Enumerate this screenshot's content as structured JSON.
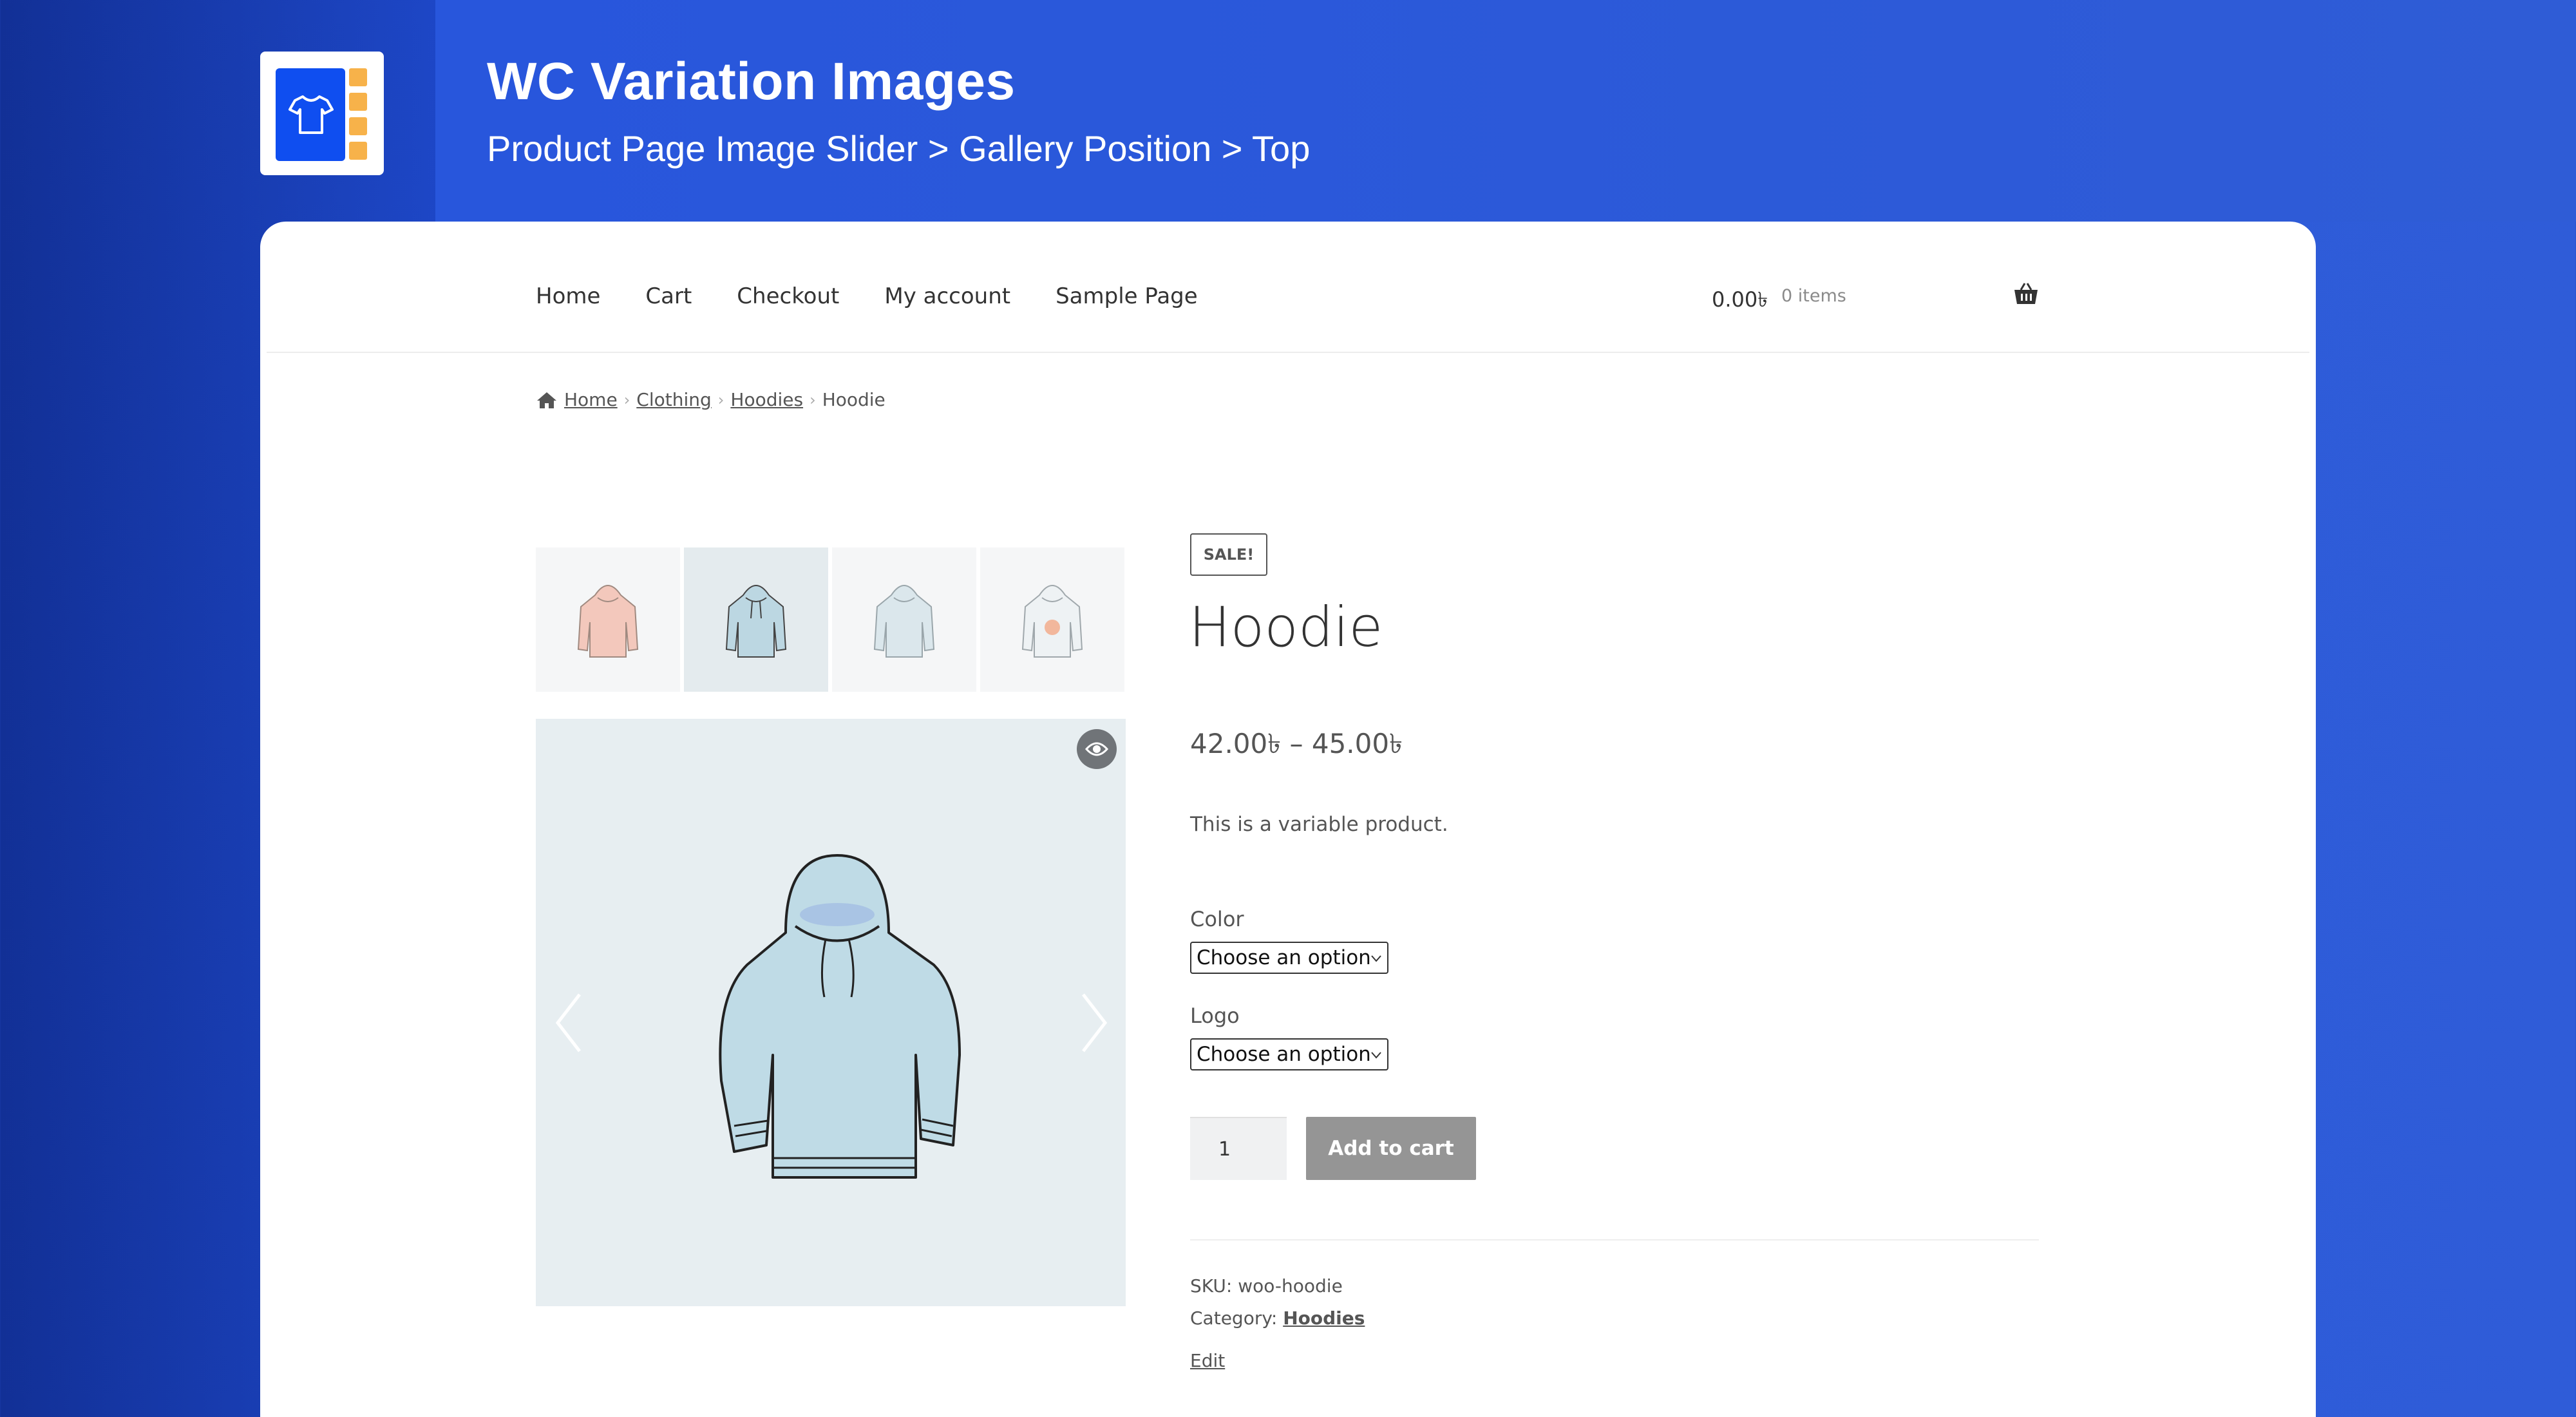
{
  "header": {
    "title": "WC Variation Images",
    "subtitle": "Product Page Image Slider > Gallery Position > Top",
    "logo_icon": "tshirt-gallery-icon"
  },
  "nav": {
    "items": [
      "Home",
      "Cart",
      "Checkout",
      "My account",
      "Sample Page"
    ],
    "cart_amount": "0.00৳",
    "cart_items": "0 items",
    "cart_icon": "basket-icon"
  },
  "breadcrumb": {
    "items": [
      "Home",
      "Clothing",
      "Hoodies",
      "Hoodie"
    ],
    "home_icon": "home-icon"
  },
  "gallery": {
    "thumbnails": [
      "pink-hoodie",
      "blue-hoodie",
      "blue-hoodie-light",
      "hoodie-with-logo"
    ],
    "active_index": 1,
    "zoom_icon": "eye-icon",
    "colors": {
      "pink": "#f3c8bc",
      "blue": "#bcd7e2",
      "outline": "#333333"
    }
  },
  "product": {
    "badge": "SALE!",
    "title": "Hoodie",
    "price": "42.00৳  – 45.00৳",
    "description": "This is a variable product.",
    "color_label": "Color",
    "color_value": "Choose an option",
    "logo_label": "Logo",
    "logo_value": "Choose an option",
    "quantity": "1",
    "add_to_cart": "Add to cart",
    "sku_label": "SKU:",
    "sku": "woo-hoodie",
    "category_label": "Category:",
    "category": "Hoodies",
    "edit": "Edit"
  }
}
